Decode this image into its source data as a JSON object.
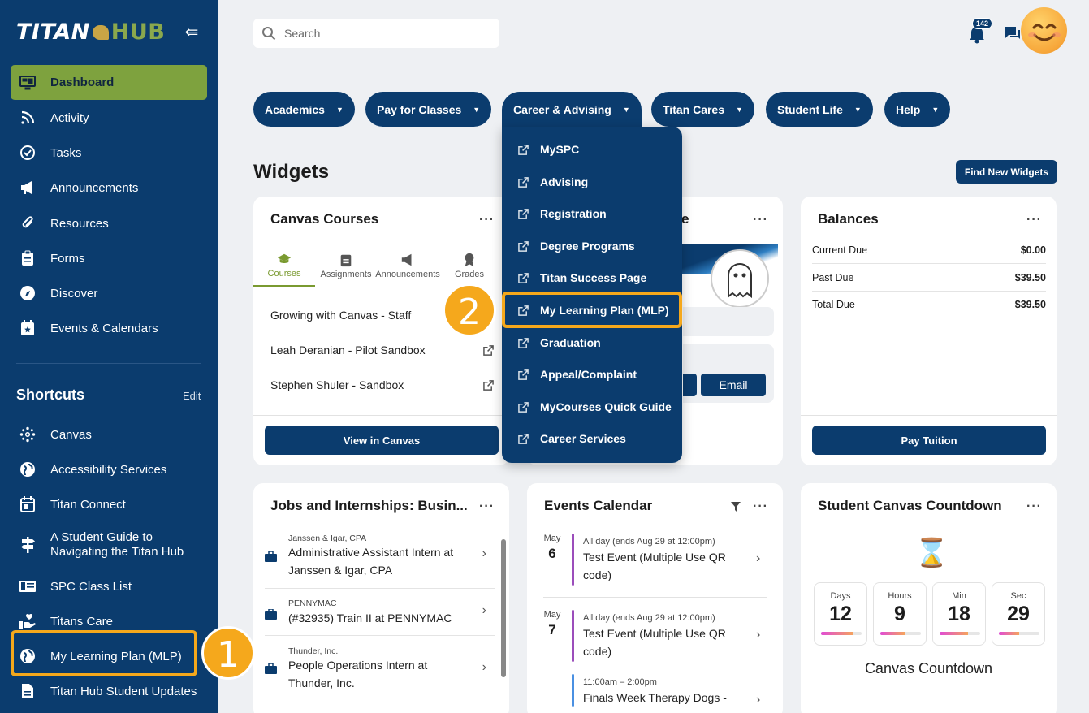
{
  "app": {
    "logo_titan": "TITAN",
    "logo_hub": "HUB",
    "collapse_glyph": "⇚"
  },
  "sidebar": {
    "nav": [
      {
        "label": "Dashboard",
        "icon": "dashboard-icon"
      },
      {
        "label": "Activity",
        "icon": "rss-icon"
      },
      {
        "label": "Tasks",
        "icon": "check-circle-icon"
      },
      {
        "label": "Announcements",
        "icon": "megaphone-icon"
      },
      {
        "label": "Resources",
        "icon": "paperclip-icon"
      },
      {
        "label": "Forms",
        "icon": "clipboard-icon"
      },
      {
        "label": "Discover",
        "icon": "compass-icon"
      },
      {
        "label": "Events & Calendars",
        "icon": "calendar-star-icon"
      }
    ],
    "shortcuts_title": "Shortcuts",
    "shortcuts_edit": "Edit",
    "shortcuts": [
      {
        "label": "Canvas",
        "icon": "canvas-icon"
      },
      {
        "label": "Accessibility Services",
        "icon": "globe-icon"
      },
      {
        "label": "Titan Connect",
        "icon": "calendar-icon"
      },
      {
        "label": "A Student Guide to Navigating the Titan Hub",
        "line1": "A Student Guide to",
        "line2": "Navigating the Titan Hub",
        "icon": "signpost-icon"
      },
      {
        "label": "SPC Class List",
        "icon": "book-icon"
      },
      {
        "label": "Titans Care",
        "icon": "hand-heart-icon"
      },
      {
        "label": "My Learning Plan (MLP)",
        "icon": "globe-icon"
      },
      {
        "label": "Titan Hub Student Updates",
        "icon": "document-icon"
      }
    ]
  },
  "topbar": {
    "search_placeholder": "Search",
    "notification_count": "142"
  },
  "menu": [
    {
      "label": "Academics"
    },
    {
      "label": "Pay for Classes"
    },
    {
      "label": "Career & Advising"
    },
    {
      "label": "Titan Cares"
    },
    {
      "label": "Student Life"
    },
    {
      "label": "Help"
    }
  ],
  "dropdown": {
    "items": [
      "MySPC",
      "Advising",
      "Registration",
      "Degree Programs",
      "Titan Success Page",
      "My Learning Plan (MLP)",
      "Graduation",
      "Appeal/Complaint",
      "MyCourses Quick Guide",
      "Career Services"
    ],
    "highlighted": "My Learning Plan (MLP)"
  },
  "annotations": {
    "step1": "1",
    "step2": "2",
    "highlight_color": "#f5a81c"
  },
  "widgets": {
    "title": "Widgets",
    "find_new": "Find New Widgets",
    "canvas": {
      "title": "Canvas Courses",
      "more": "···",
      "tabs": [
        "Courses",
        "Assignments",
        "Announcements",
        "Grades"
      ],
      "courses": [
        "Growing with Canvas - Staff",
        "Leah Deranian - Pilot Sandbox",
        "Stephen Shuler - Sandbox"
      ],
      "button": "View in Canvas"
    },
    "advisor": {
      "title_tail": "e",
      "more": "···",
      "email_button": "Email"
    },
    "balances": {
      "title": "Balances",
      "more": "···",
      "rows": [
        {
          "label": "Current Due",
          "value": "$0.00"
        },
        {
          "label": "Past Due",
          "value": "$39.50"
        },
        {
          "label": "Total Due",
          "value": "$39.50"
        }
      ],
      "button": "Pay Tuition"
    },
    "jobs": {
      "title": "Jobs and Internships: Busin...",
      "more": "···",
      "items": [
        {
          "company": "Janssen & Igar, CPA",
          "title": "Administrative Assistant Intern at Janssen & Igar, CPA"
        },
        {
          "company": "PENNYMAC",
          "title": "(#32935) Train II at PENNYMAC"
        },
        {
          "company": "Thunder, Inc.",
          "title": "People Operations Intern at Thunder, Inc."
        }
      ]
    },
    "events": {
      "title": "Events Calendar",
      "more": "···",
      "items": [
        {
          "month": "May",
          "day": "6",
          "when": "All day (ends Aug 29 at 12:00pm)",
          "title": "Test Event (Multiple Use QR code)"
        },
        {
          "month": "May",
          "day": "7",
          "when": "All day (ends Aug 29 at 12:00pm)",
          "title": "Test Event (Multiple Use QR code)"
        },
        {
          "month": "",
          "day": "",
          "when": "11:00am – 2:00pm",
          "title": "Finals Week Therapy Dogs -"
        }
      ]
    },
    "countdown": {
      "title": "Student Canvas Countdown",
      "more": "···",
      "hourglass": "⌛",
      "units": [
        {
          "label": "Days",
          "value": "12",
          "level": 0.8
        },
        {
          "label": "Hours",
          "value": "9",
          "level": 0.6
        },
        {
          "label": "Min",
          "value": "18",
          "level": 0.7
        },
        {
          "label": "Sec",
          "value": "29",
          "level": 0.5
        }
      ],
      "caption": "Canvas Countdown"
    }
  }
}
